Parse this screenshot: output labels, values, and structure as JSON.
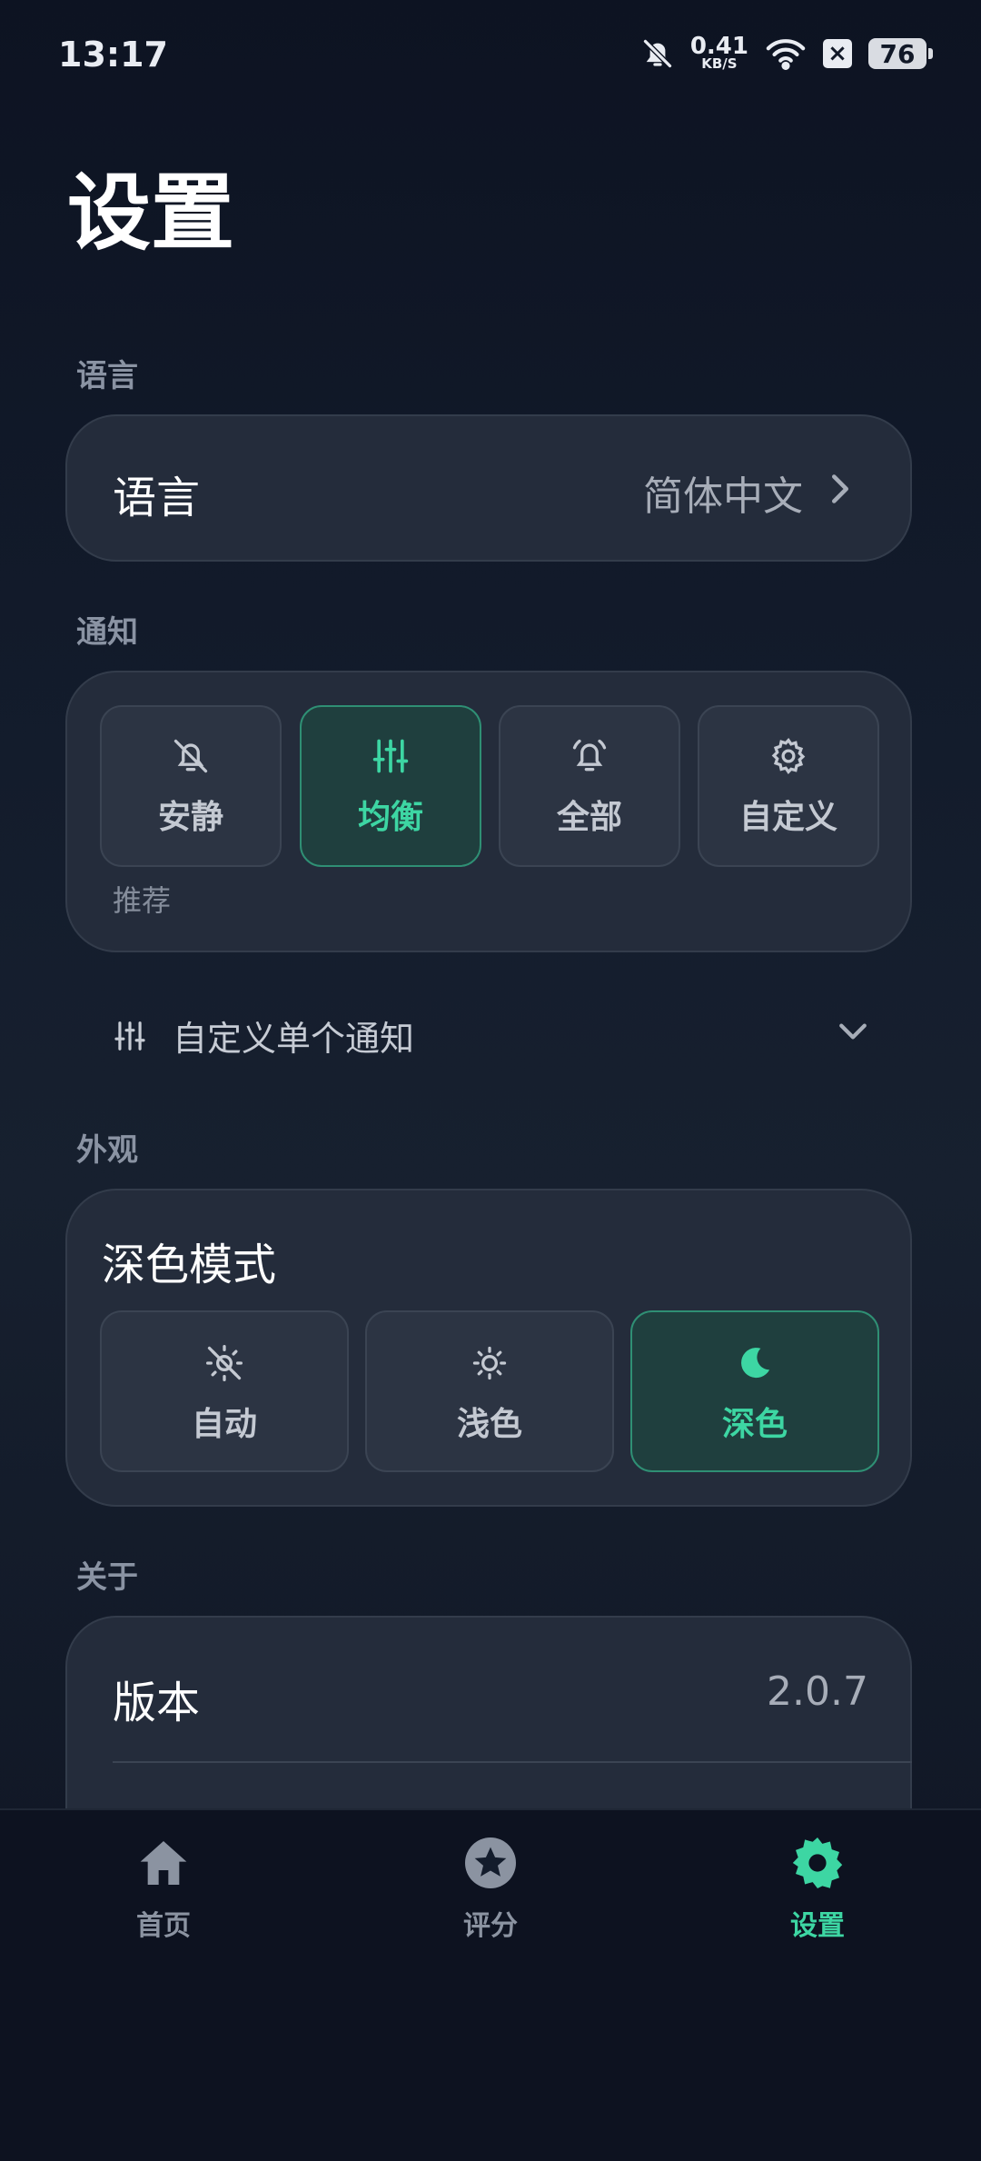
{
  "status_bar": {
    "time": "13:17",
    "net_speed": "0.41",
    "net_unit": "KB/S",
    "battery": "76"
  },
  "page": {
    "title": "设置"
  },
  "language_section": {
    "label": "语言",
    "row_title": "语言",
    "row_value": "简体中文"
  },
  "notification_section": {
    "label": "通知",
    "modes": [
      {
        "label": "安静",
        "icon": "bell-off-icon"
      },
      {
        "label": "均衡",
        "icon": "sliders-icon",
        "active": true
      },
      {
        "label": "全部",
        "icon": "bell-ring-icon"
      },
      {
        "label": "自定义",
        "icon": "gear-icon"
      }
    ],
    "recommended_note": "推荐",
    "custom_single": "自定义单个通知"
  },
  "appearance_section": {
    "label": "外观",
    "dark_mode_title": "深色模式",
    "themes": [
      {
        "label": "自动",
        "icon": "auto-brightness-icon"
      },
      {
        "label": "浅色",
        "icon": "sun-icon"
      },
      {
        "label": "深色",
        "icon": "moon-icon",
        "active": true
      }
    ]
  },
  "about_section": {
    "label": "关于",
    "version_title": "版本",
    "version_value": "2.0.7"
  },
  "bottom_nav": {
    "items": [
      {
        "label": "首页",
        "icon": "home-icon"
      },
      {
        "label": "评分",
        "icon": "star-icon"
      },
      {
        "label": "设置",
        "icon": "gear-icon",
        "active": true
      }
    ]
  },
  "colors": {
    "accent": "#3dd6a3",
    "card": "#242c3b",
    "background": "#131c2c"
  }
}
